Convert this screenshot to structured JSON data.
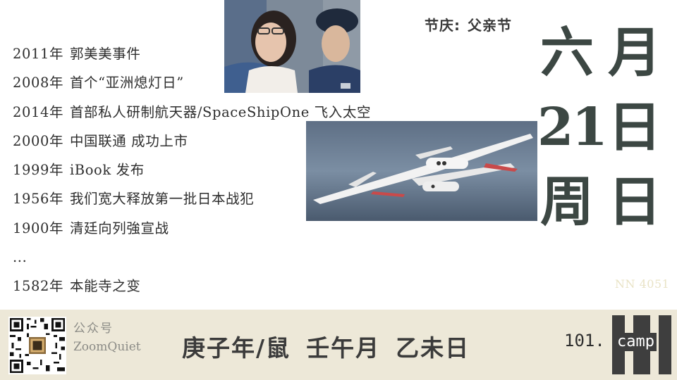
{
  "events": [
    {
      "year": "2011年",
      "text": "郭美美事件"
    },
    {
      "year": "2008年",
      "text": "首个“亚洲熄灯日”"
    },
    {
      "year": "2014年",
      "text": "首部私人研制航天器/SpaceShipOne 飞入太空"
    },
    {
      "year": "2000年",
      "text": "中国联通 成功上市"
    },
    {
      "year": "1999年",
      "text": "iBook 发布"
    },
    {
      "year": "1956年",
      "text": "我们宽大释放第一批日本战犯"
    },
    {
      "year": "1900年",
      "text": "清廷向列強宣战"
    },
    {
      "year": "",
      "text": "..."
    },
    {
      "year": "1582年",
      "text": "本能寺之变"
    }
  ],
  "festival": {
    "label": "节庆:",
    "name": "父亲节"
  },
  "date": {
    "month_num": "六",
    "month_char": "月",
    "day_num": "21",
    "day_char": "日",
    "week_label": "周",
    "weekday": "日"
  },
  "watermark": "NN 4051",
  "footer": {
    "gzh_label": "公众号",
    "gzh_name": "ZoomQuiet",
    "ganzhi": {
      "year": "庚子年/鼠",
      "month": "壬午月",
      "day": "乙未日"
    },
    "brand_num": "101.",
    "brand_camp": "camp"
  },
  "icons": [
    "qr-code-icon",
    "portrait-photo",
    "spaceship-photo",
    "brand-logo-icon"
  ],
  "colors": {
    "footer_bg": "#ede8d8",
    "date_text": "#3c4743",
    "watermark": "#e9e3c6"
  }
}
